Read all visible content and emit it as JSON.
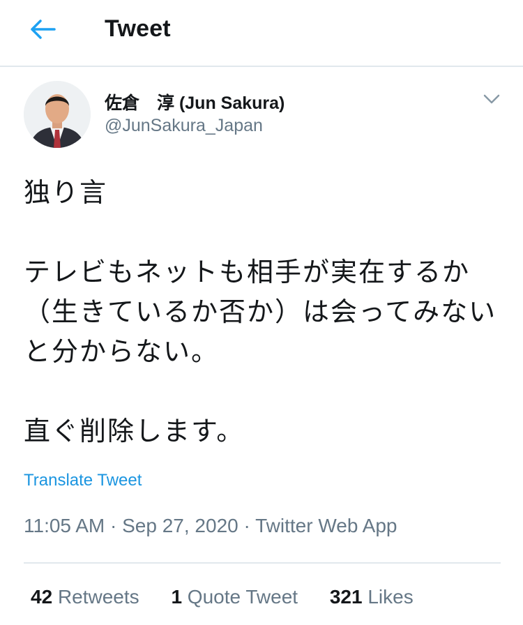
{
  "header": {
    "title": "Tweet",
    "back_icon": "arrow-left-icon",
    "accent_color": "#1da1f2"
  },
  "tweet": {
    "author": {
      "name": "佐倉　淳 (Jun Sakura)",
      "handle": "@JunSakura_Japan"
    },
    "menu_icon": "chevron-down-icon",
    "text": "独り言\n\nテレビもネットも相手が実在するか（生きているか否か）は会ってみないと分からない。\n\n直ぐ削除します。",
    "translate_label": "Translate Tweet",
    "time": "11:05 AM",
    "separator": " · ",
    "date": "Sep 27, 2020",
    "source": "Twitter Web App",
    "stats": {
      "retweets": {
        "count": "42",
        "label": "Retweets"
      },
      "quotes": {
        "count": "1",
        "label": "Quote Tweet"
      },
      "likes": {
        "count": "321",
        "label": "Likes"
      }
    }
  }
}
